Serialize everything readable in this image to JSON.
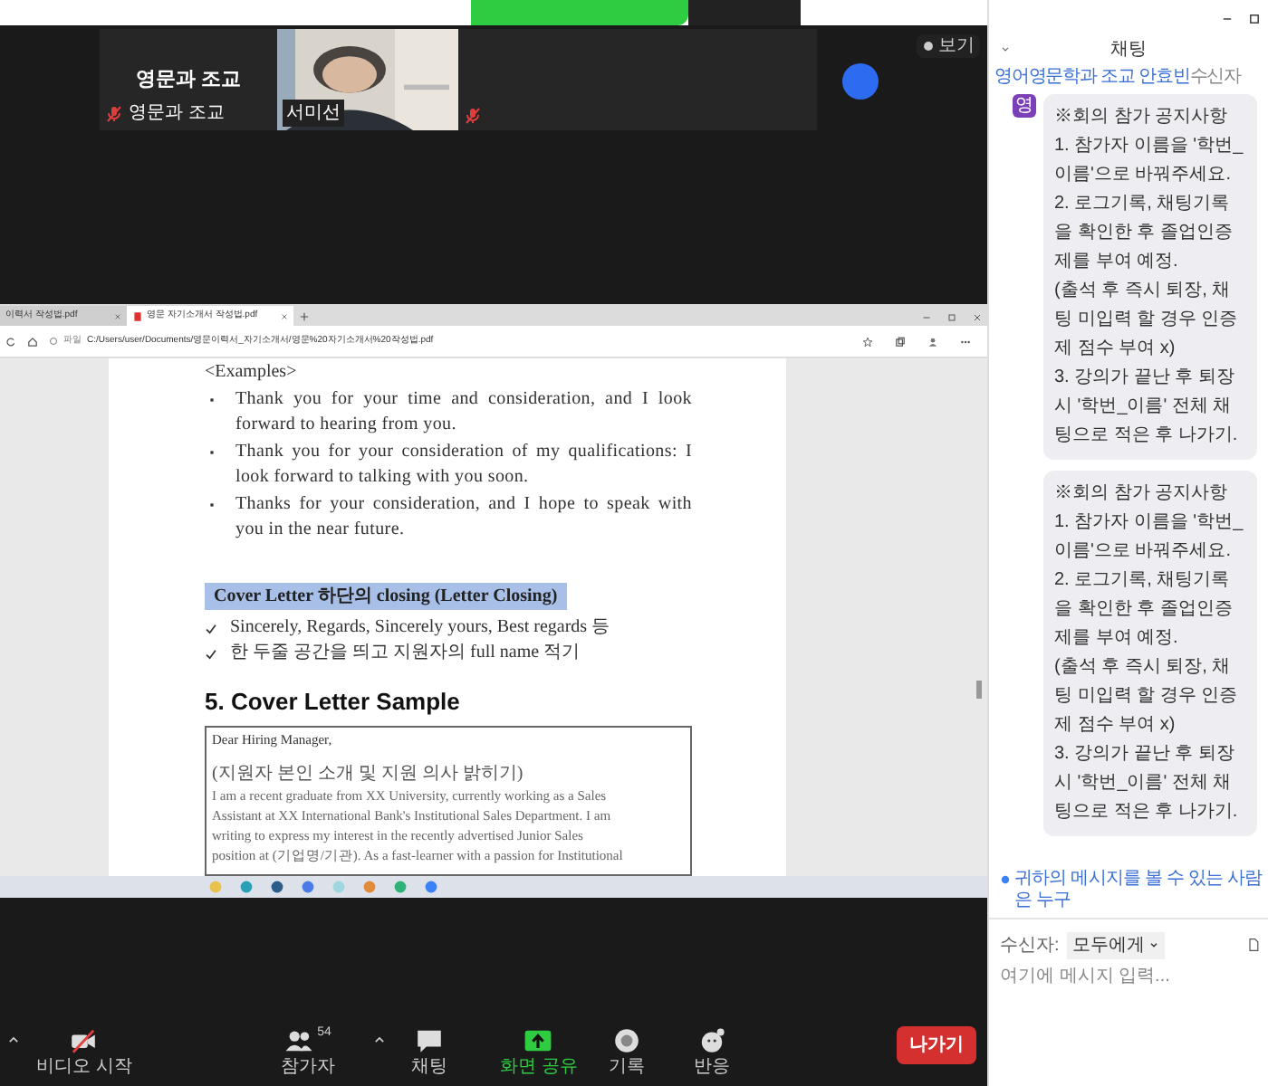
{
  "meeting": {
    "view_button": "보기"
  },
  "video_tiles": [
    {
      "kind": "name",
      "name": "영문과 조교",
      "label": "영문과 조교",
      "muted": true
    },
    {
      "kind": "video",
      "label": "서미선",
      "muted": false
    },
    {
      "kind": "hidden",
      "muted": true
    }
  ],
  "shared_screen": {
    "tabs": [
      {
        "title": "이력서 작성법.pdf",
        "selected": false
      },
      {
        "title": "영문 자기소개서 작성법.pdf",
        "selected": true
      }
    ],
    "address_prefix": "파일",
    "address": "C:/Users/user/Documents/영문이력서_자기소개서/영문%20자기소개서%20작성법.pdf",
    "document": {
      "examples_heading": "<Examples>",
      "bullets": [
        "Thank you for your time and consideration, and I look forward to hearing from you.",
        "Thank you for your consideration of my qualifications: I look forward to talking with you soon.",
        "Thanks for your consideration, and I hope to speak with you in the near future."
      ],
      "highlight": "Cover Letter 하단의 closing (Letter Closing)",
      "checks": [
        "Sincerely, Regards, Sincerely yours, Best regards 등",
        "한 두줄 공간을 띄고 지원자의 full name 적기"
      ],
      "section_title": "5. Cover Letter Sample",
      "letter": {
        "greeting": "Dear Hiring Manager,",
        "note": "(지원자 본인 소개 및 지원 의사 밝히기)",
        "lines": [
          "I am a recent graduate from XX University, currently working as a Sales",
          "Assistant at XX International Bank's Institutional Sales Department. I am",
          "writing to express my interest in the recently advertised Junior Sales",
          "position at (기업명/기관). As a fast-learner with a passion for Institutional"
        ]
      }
    }
  },
  "toolbar": {
    "items": [
      {
        "kind": "video",
        "label": "비디오 시작",
        "active": false
      },
      {
        "kind": "participants",
        "label": "참가자",
        "count": "54",
        "active": false
      },
      {
        "kind": "chat",
        "label": "채팅",
        "active": false
      },
      {
        "kind": "share",
        "label": "화면 공유",
        "active": true
      },
      {
        "kind": "record",
        "label": "기록",
        "active": false
      },
      {
        "kind": "reactions",
        "label": "반응",
        "active": false
      }
    ],
    "leave_button": "나가기"
  },
  "chat": {
    "title": "채팅",
    "sender": "영어영문학과 조교 안효빈",
    "recipient_cut": "수신자",
    "avatar": "영",
    "messages": [
      {
        "lines": [
          "※회의 참가 공지사항",
          "1. 참가자 이름을 '학번_이름'으로 바꿔주세요.",
          "2. 로그기록, 채팅기록을 확인한 후 졸업인증제를 부여 예정.",
          "(출석 후 즉시 퇴장, 채팅 미입력 할 경우 인증제 점수 부여 x)",
          "3. 강의가 끝난 후 퇴장 시 '학번_이름' 전체 채팅으로 적은 후 나가기."
        ]
      },
      {
        "lines": [
          "※회의 참가 공지사항",
          "1. 참가자 이름을 '학번_이름'으로 바꿔주세요.",
          "2. 로그기록, 채팅기록을 확인한 후 졸업인증제를 부여 예정.",
          "(출석 후 즉시 퇴장, 채팅 미입력 할 경우 인증제 점수 부여 x)",
          "3. 강의가 끝난 후 퇴장 시 '학번_이름' 전체 채팅으로 적은 후 나가기."
        ]
      }
    ],
    "visibility_note": "귀하의 메시지를 볼 수 있는 사람은 누구",
    "recipient_label": "수신자:",
    "recipient": "모두에게",
    "placeholder": "여기에 메시지 입력..."
  }
}
